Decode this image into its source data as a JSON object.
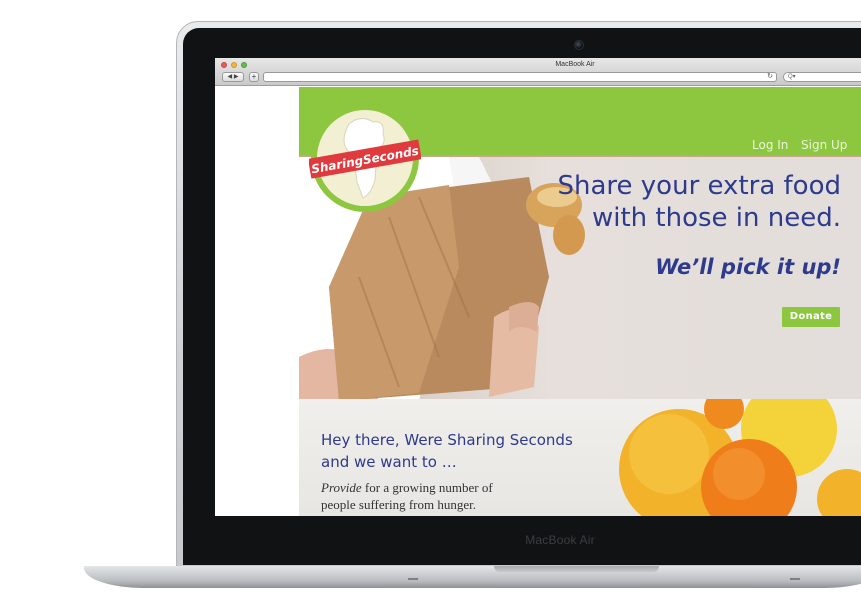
{
  "window": {
    "title": "MacBook Air",
    "nav_back_forward": "◀ ▶",
    "new_tab": "+",
    "reload_icon": "reload-icon",
    "search_placeholder": "Q▾"
  },
  "laptop": {
    "label": "MacBook Air"
  },
  "site": {
    "logo_text": "SharingSeconds",
    "nav": {
      "login": "Log In",
      "signup": "Sign Up"
    },
    "hero": {
      "line1": "Share your extra food",
      "line2": "with those in need.",
      "tagline": "We’ll pick it up!",
      "donate": "Donate"
    },
    "intro": {
      "heading_line1": "Hey there, Were Sharing Seconds",
      "heading_line2": "and we want to …",
      "body_em": "Provide",
      "body_rest1": " for a growing number of",
      "body_rest2": "people suffering from hunger."
    }
  },
  "colors": {
    "brand_green": "#8dc63f",
    "brand_navy": "#2e3a8c",
    "logo_red": "#e03a3e"
  }
}
